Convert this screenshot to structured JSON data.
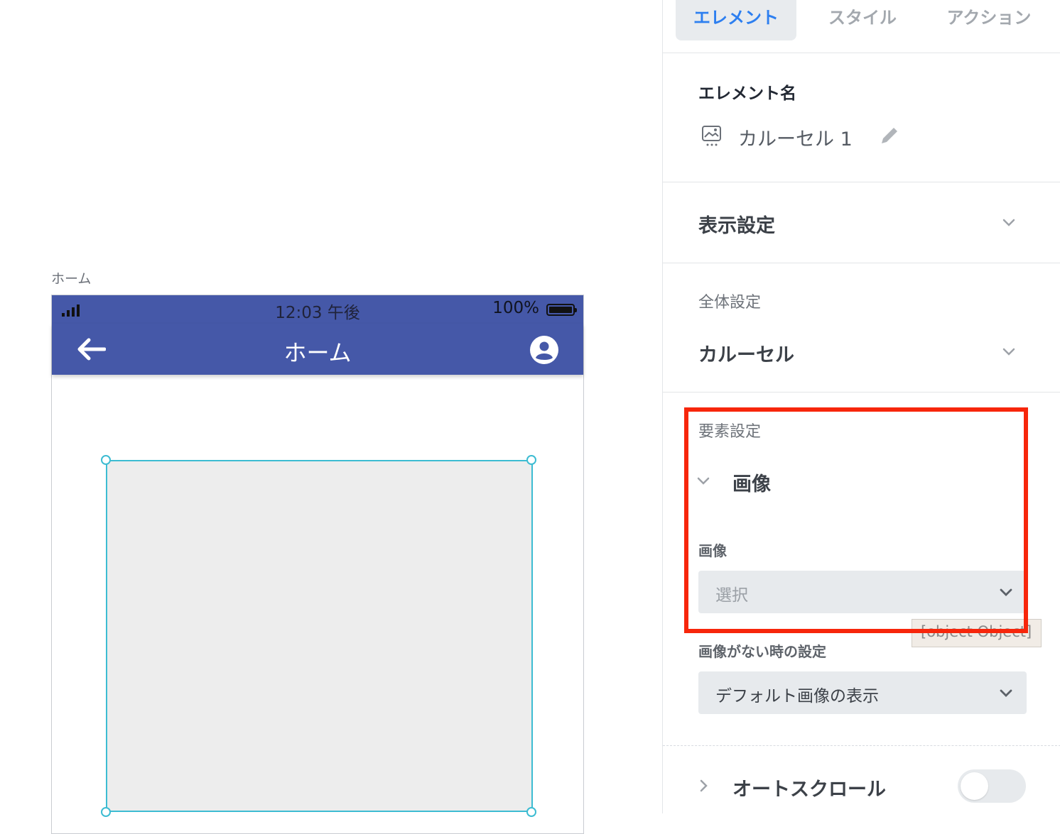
{
  "canvas": {
    "screen_label": "ホーム",
    "status_bar": {
      "time": "12:03 午後",
      "battery": "100%"
    },
    "app_bar": {
      "title": "ホーム"
    }
  },
  "panel": {
    "tabs": [
      {
        "label": "エレメント",
        "active": true
      },
      {
        "label": "スタイル",
        "active": false
      },
      {
        "label": "アクション",
        "active": false
      }
    ],
    "element_name": {
      "heading": "エレメント名",
      "value": "カルーセル 1"
    },
    "display_settings": {
      "label": "表示設定"
    },
    "overall_settings": {
      "sublabel": "全体設定",
      "value": "カルーセル"
    },
    "item_settings": {
      "sublabel": "要素設定",
      "group_title": "画像",
      "image_field": {
        "label": "画像",
        "value": "選択"
      },
      "no_image_field": {
        "label": "画像がない時の設定",
        "value": "デフォルト画像の表示"
      }
    },
    "tooltip": "[object Object]",
    "auto_scroll": {
      "label": "オートスクロール",
      "enabled": false
    }
  },
  "colors": {
    "app_bar": "#4558a8",
    "accent": "#2d7ff0",
    "selection": "#3dbcd2",
    "highlight": "#f7260b"
  }
}
